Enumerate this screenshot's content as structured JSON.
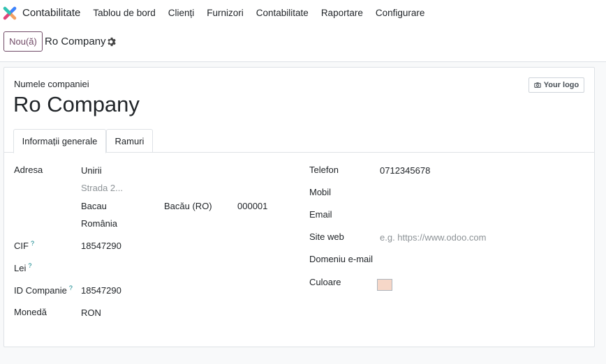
{
  "app": {
    "name": "Contabilitate",
    "logo_icon": "odoo-app-icon"
  },
  "menu": [
    {
      "label": "Tablou de bord"
    },
    {
      "label": "Clienți"
    },
    {
      "label": "Furnizori"
    },
    {
      "label": "Contabilitate"
    },
    {
      "label": "Raportare"
    },
    {
      "label": "Configurare"
    }
  ],
  "controls": {
    "new_label": "Nou(ă)",
    "record_title": "Ro Company",
    "settings_icon": "gear-icon"
  },
  "form": {
    "name_caption": "Numele companiei",
    "company_name": "Ro Company",
    "logo_label": "Your logo",
    "tabs": [
      {
        "label": "Informații generale",
        "active": true
      },
      {
        "label": "Ramuri",
        "active": false
      }
    ],
    "left": {
      "address_label": "Adresa",
      "street": "Unirii",
      "street2_placeholder": "Strada 2...",
      "city": "Bacau",
      "state": "Bacău (RO)",
      "zip": "000001",
      "country": "România",
      "vat_label": "CIF",
      "vat_value": "18547290",
      "lei_label": "Lei",
      "lei_value": "",
      "company_id_label": "ID Companie",
      "company_id_value": "18547290",
      "currency_label": "Monedă",
      "currency_value": "RON",
      "help_mark": "?"
    },
    "right": {
      "phone_label": "Telefon",
      "phone_value": "0712345678",
      "mobile_label": "Mobil",
      "mobile_value": "",
      "email_label": "Email",
      "email_value": "",
      "website_label": "Site web",
      "website_placeholder": "e.g. https://www.odoo.com",
      "email_domain_label": "Domeniu e-mail",
      "email_domain_value": "",
      "color_label": "Culoare",
      "color_value": "#f6d7c8"
    }
  }
}
